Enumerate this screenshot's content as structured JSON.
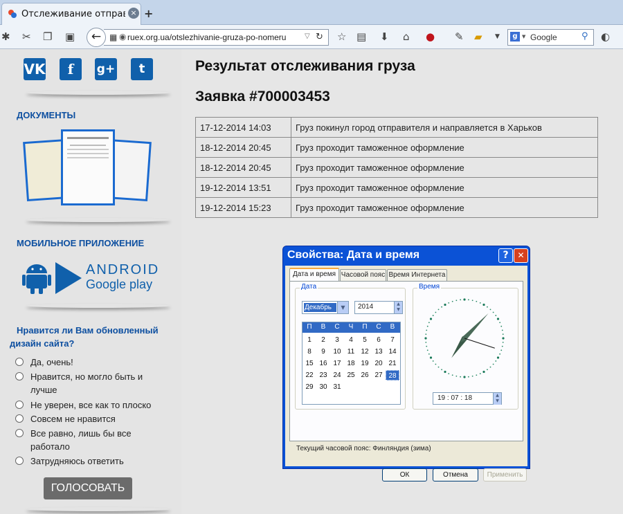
{
  "browser": {
    "tab_title": "Отслеживание отправленн",
    "tab_close": "×",
    "new_tab": "+",
    "url": "ruex.org.ua/otslezhivanie-gruza-po-nomeru",
    "search_engine": "Google"
  },
  "sidebar": {
    "social": [
      {
        "label": "VK",
        "name": "vk-icon"
      },
      {
        "label": "f",
        "name": "facebook-icon"
      },
      {
        "label": "g+",
        "name": "google-plus-icon"
      },
      {
        "label": "t",
        "name": "twitter-icon"
      }
    ],
    "documents_heading": "ДОКУМЕНТЫ",
    "mobile_heading": "МОБИЛЬНОЕ ПРИЛОЖЕНИЕ",
    "android_text": "ANDROID",
    "google_play_text": "Google play",
    "poll_question": "Нравится ли Вам обновленный дизайн сайта?",
    "poll_options": [
      "Да, очень!",
      "Нравится, но могло быть и лучше",
      "Не уверен, все как то плоско",
      "Совсем не нравится",
      "Все равно, лишь бы все работало",
      "Затрудняюсь ответить"
    ],
    "vote_button": "ГОЛОСОВАТЬ"
  },
  "main": {
    "title": "Результат отслеживания груза",
    "order": "Заявка #700003453",
    "rows": [
      {
        "date": "17-12-2014 14:03",
        "status": "Груз покинул город отправителя и направляется в Харьков"
      },
      {
        "date": "18-12-2014 20:45",
        "status": "Груз проходит таможенное оформление"
      },
      {
        "date": "18-12-2014 20:45",
        "status": "Груз проходит таможенное оформление"
      },
      {
        "date": "19-12-2014 13:51",
        "status": "Груз проходит таможенное оформление"
      },
      {
        "date": "19-12-2014 15:23",
        "status": "Груз проходит таможенное оформление"
      }
    ]
  },
  "dialog": {
    "title": "Свойства: Дата и время",
    "help": "?",
    "close": "✕",
    "tabs": [
      "Дата и время",
      "Часовой пояс",
      "Время Интернета"
    ],
    "date_group": "Дата",
    "time_group": "Время",
    "month": "Декабрь",
    "year": "2014",
    "weekdays": [
      "П",
      "В",
      "С",
      "Ч",
      "П",
      "С",
      "В"
    ],
    "weeks": [
      [
        "1",
        "2",
        "3",
        "4",
        "5",
        "6",
        "7"
      ],
      [
        "8",
        "9",
        "10",
        "11",
        "12",
        "13",
        "14"
      ],
      [
        "15",
        "16",
        "17",
        "18",
        "19",
        "20",
        "21"
      ],
      [
        "22",
        "23",
        "24",
        "25",
        "26",
        "27",
        "28"
      ],
      [
        "29",
        "30",
        "31",
        "",
        "",
        "",
        ""
      ]
    ],
    "selected_day": "28",
    "time": "19 : 07 : 18",
    "timezone": "Текущий часовой пояс: Финляндия (зима)",
    "ok": "ОК",
    "cancel": "Отмена",
    "apply": "Применить"
  },
  "colors": {
    "accent": "#0d4fa0",
    "social_blue": "#1060ab",
    "xp_title": "#0b52d6"
  }
}
